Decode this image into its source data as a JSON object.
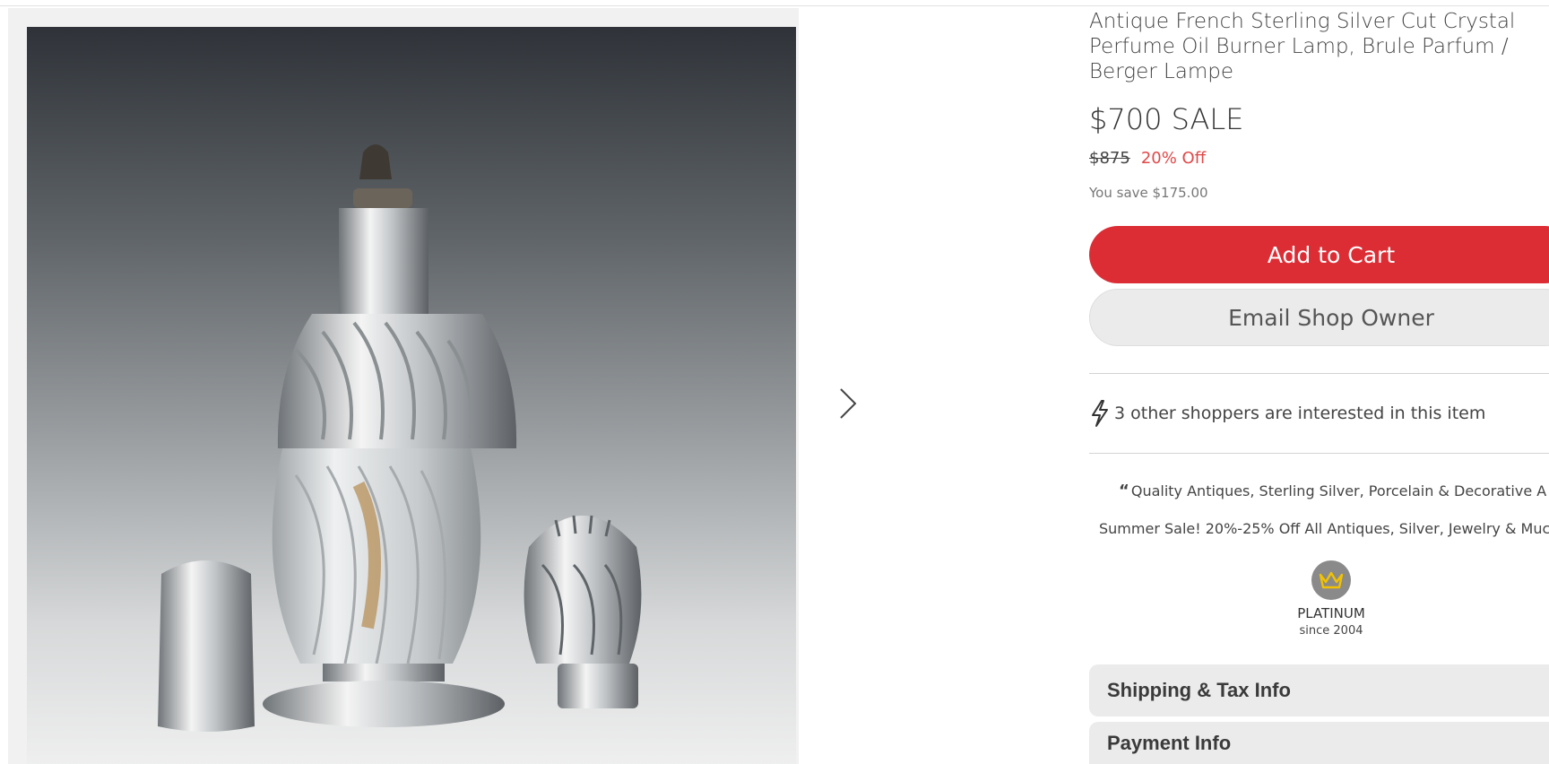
{
  "product": {
    "title": "Antique French Sterling Silver Cut Crystal Perfume Oil Burner Lamp, Brule Parfum / Berger Lampe",
    "price": "$700 SALE",
    "original_price": "$875",
    "discount": "20% Off",
    "savings": "You save $175.00"
  },
  "actions": {
    "add_to_cart": "Add to Cart",
    "email_owner": "Email Shop Owner"
  },
  "interest": {
    "text": "3 other shoppers are interested in this item",
    "icon": "lightning-icon"
  },
  "shop": {
    "tagline": "Quality Antiques, Sterling Silver, Porcelain & Decorative A",
    "promo": "Summer Sale! 20%-25% Off All Antiques, Silver, Jewelry & Muc",
    "badge_level": "PLATINUM",
    "badge_since": "since 2004",
    "badge_icon": "crown-icon"
  },
  "accordions": [
    {
      "label": "Shipping & Tax Info"
    },
    {
      "label": "Payment Info"
    }
  ],
  "colors": {
    "accent": "#dc2d35",
    "discount": "#e04848",
    "crown": "#f2c200"
  }
}
